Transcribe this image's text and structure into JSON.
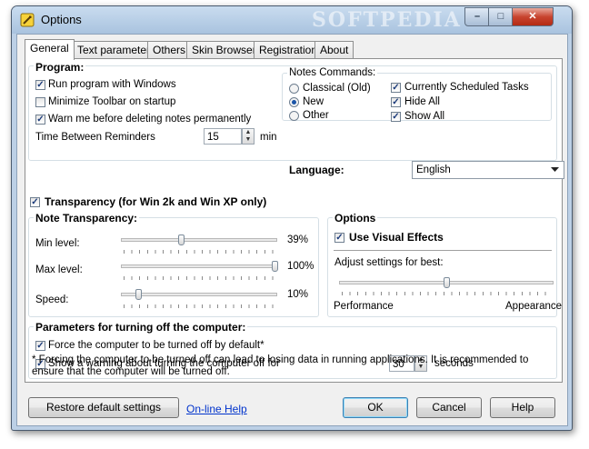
{
  "window": {
    "title": "Options",
    "watermark": "SOFTPEDIA",
    "controls": {
      "minimize": "–",
      "maximize": "□",
      "close": "✕"
    }
  },
  "tabs": [
    {
      "label": "General",
      "active": true
    },
    {
      "label": "Text parameters"
    },
    {
      "label": "Others"
    },
    {
      "label": "Skin Browser"
    },
    {
      "label": "Registration"
    },
    {
      "label": "About"
    }
  ],
  "program": {
    "header": "Program:",
    "run_with_windows": "Run program with Windows",
    "minimize_toolbar": "Minimize Toolbar on startup",
    "warn_delete": "Warn me before deleting notes permanently",
    "reminders_label": "Time Between Reminders",
    "reminders_value": "15",
    "reminders_unit": "min"
  },
  "notes_commands": {
    "header": "Notes Commands:",
    "classical": "Classical (Old)",
    "new": "New",
    "other": "Other",
    "scheduled": "Currently Scheduled Tasks",
    "hide_all": "Hide All",
    "show_all": "Show All"
  },
  "language": {
    "label": "Language:",
    "value": "English"
  },
  "transparency": {
    "label": "Transparency (for Win 2k and Win XP only)",
    "header": "Note Transparency:",
    "min_label": "Min level:",
    "min_value": "39%",
    "max_label": "Max level:",
    "max_value": "100%",
    "speed_label": "Speed:",
    "speed_value": "10%"
  },
  "options": {
    "header": "Options",
    "visual_effects": "Use Visual Effects",
    "adjust": "Adjust settings for best:",
    "performance": "Performance",
    "appearance": "Appearance"
  },
  "shutdown": {
    "header": "Parameters for turning off the computer:",
    "force": "Force the computer to be turned off by default*",
    "warning": "Show a warning about turning the computer off for",
    "seconds_value": "30",
    "seconds_unit": "seconds",
    "note": "* Forcing the computer to be turned off can lead to losing data in running applications. It is recommended to ensure that the computer will be turned off."
  },
  "footer": {
    "restore": "Restore default settings",
    "help_link": "On-line Help",
    "ok": "OK",
    "cancel": "Cancel",
    "help": "Help"
  },
  "colors": {
    "frame": "#bcd0e6",
    "link": "#0033cc",
    "close_button": "#c8442f"
  }
}
